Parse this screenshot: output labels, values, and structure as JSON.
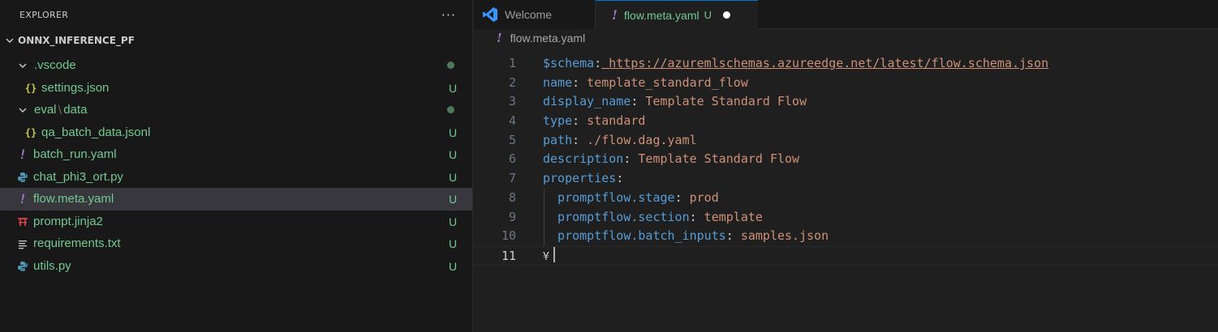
{
  "sidebar": {
    "title": "EXPLORER",
    "more": "···",
    "project": "ONNX_INFERENCE_PF",
    "items": [
      {
        "name": ".vscode",
        "type": "folder",
        "status": "dot"
      },
      {
        "name": "settings.json",
        "type": "json",
        "status": "U"
      },
      {
        "name": "eval",
        "name2": "data",
        "sep": "\\",
        "type": "folder",
        "status": "dot"
      },
      {
        "name": "qa_batch_data.jsonl",
        "type": "json",
        "status": "U"
      },
      {
        "name": "batch_run.yaml",
        "type": "yaml",
        "status": "U"
      },
      {
        "name": "chat_phi3_ort.py",
        "type": "python",
        "status": "U"
      },
      {
        "name": "flow.meta.yaml",
        "type": "yaml",
        "status": "U",
        "selected": true
      },
      {
        "name": "prompt.jinja2",
        "type": "jinja",
        "status": "U"
      },
      {
        "name": "requirements.txt",
        "type": "text",
        "status": "U"
      },
      {
        "name": "utils.py",
        "type": "python",
        "status": "U"
      }
    ]
  },
  "tabs": [
    {
      "label": "Welcome",
      "icon": "vscode-icon"
    },
    {
      "label": "flow.meta.yaml",
      "icon": "yaml-icon",
      "status": "U"
    }
  ],
  "breadcrumb": {
    "file": "flow.meta.yaml"
  },
  "code": {
    "lines": [
      {
        "n": "1",
        "key": "$schema",
        "colon": ":",
        "val": " https://azuremlschemas.azureedge.net/latest/flow.schema.json"
      },
      {
        "n": "2",
        "key": "name",
        "colon": ":",
        "val": " template_standard_flow"
      },
      {
        "n": "3",
        "key": "display_name",
        "colon": ":",
        "val": " Template Standard Flow"
      },
      {
        "n": "4",
        "key": "type",
        "colon": ":",
        "val": " standard"
      },
      {
        "n": "5",
        "key": "path",
        "colon": ":",
        "val": " ./flow.dag.yaml"
      },
      {
        "n": "6",
        "key": "description",
        "colon": ":",
        "val": " Template Standard Flow"
      },
      {
        "n": "7",
        "key": "properties",
        "colon": ":",
        "val": ""
      },
      {
        "n": "8",
        "key": "  promptflow.stage",
        "colon": ":",
        "val": " prod"
      },
      {
        "n": "9",
        "key": "  promptflow.section",
        "colon": ":",
        "val": " template"
      },
      {
        "n": "10",
        "key": "  promptflow.batch_inputs",
        "colon": ":",
        "val": " samples.json"
      },
      {
        "n": "11",
        "key": "",
        "colon": "",
        "val": "",
        "whitespace": "¥"
      }
    ]
  },
  "colors": {
    "accent": "#0078d4",
    "untracked": "#73c991",
    "key": "#569cd6",
    "string": "#ce9178"
  }
}
